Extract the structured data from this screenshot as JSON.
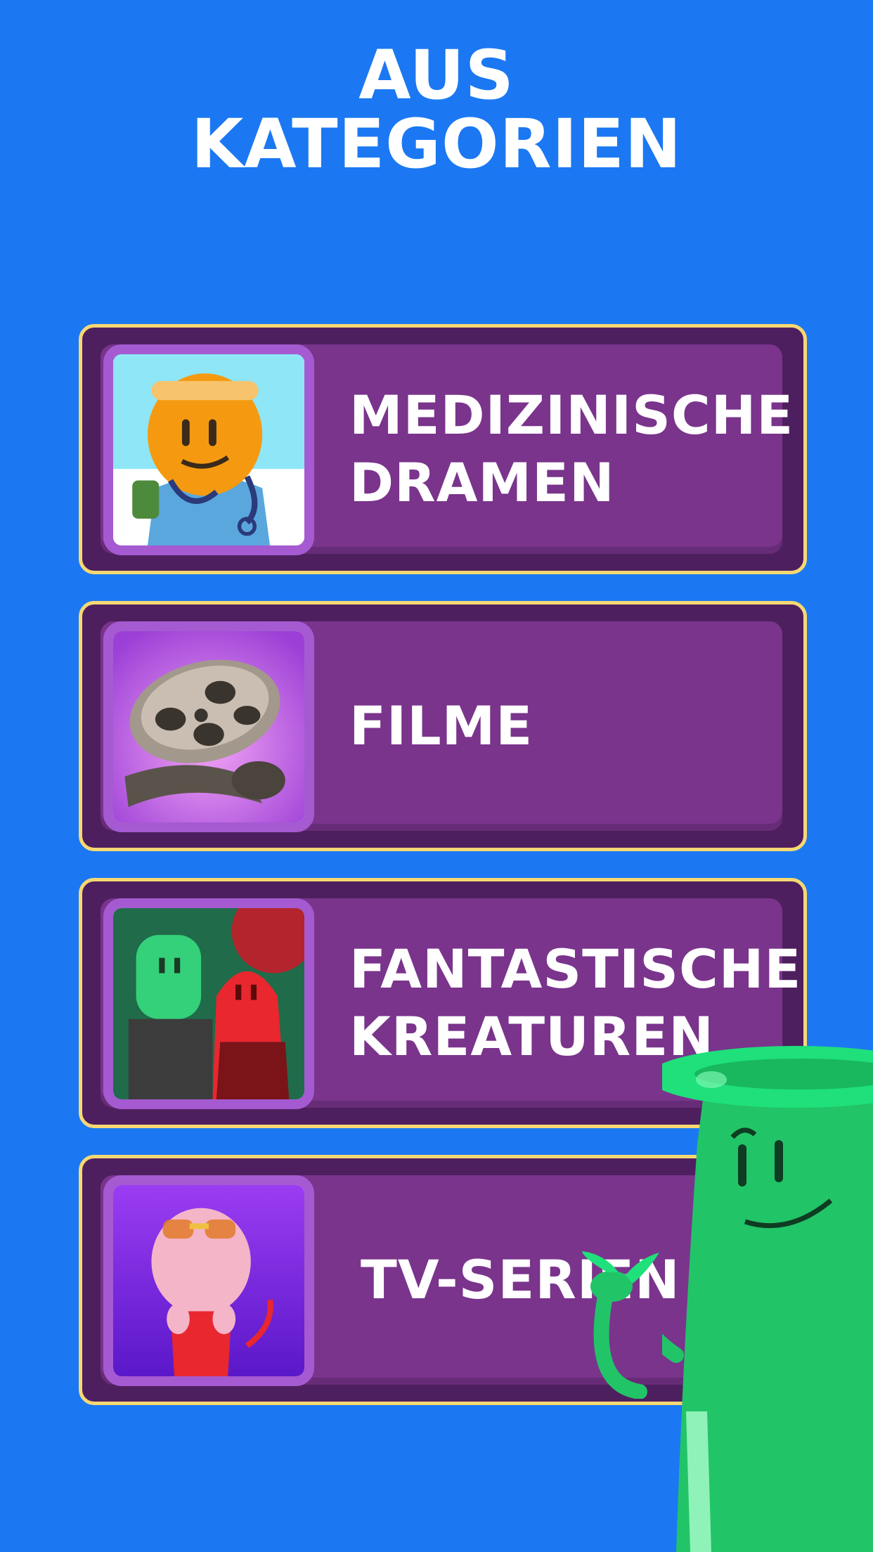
{
  "header": {
    "title_line1": "AUS",
    "title_line2": "KATEGORIEN"
  },
  "categories": [
    {
      "label": "MEDIZINISCHE\nDRAMEN",
      "icon": "doctor-character-icon"
    },
    {
      "label": "FILME",
      "icon": "film-reel-icon"
    },
    {
      "label": "FANTASTISCHE\nKREATUREN",
      "icon": "creatures-icon"
    },
    {
      "label": "TV-SERIEN",
      "icon": "turkey-character-icon"
    }
  ],
  "colors": {
    "background": "#1b78f2",
    "card_border": "#f7d873",
    "card_dark": "#4e1f5e",
    "card_fill": "#7a348c",
    "thumb_frame": "#a55ad1",
    "mascot": "#22c468"
  },
  "mascot": {
    "icon": "green-mascot-character"
  }
}
